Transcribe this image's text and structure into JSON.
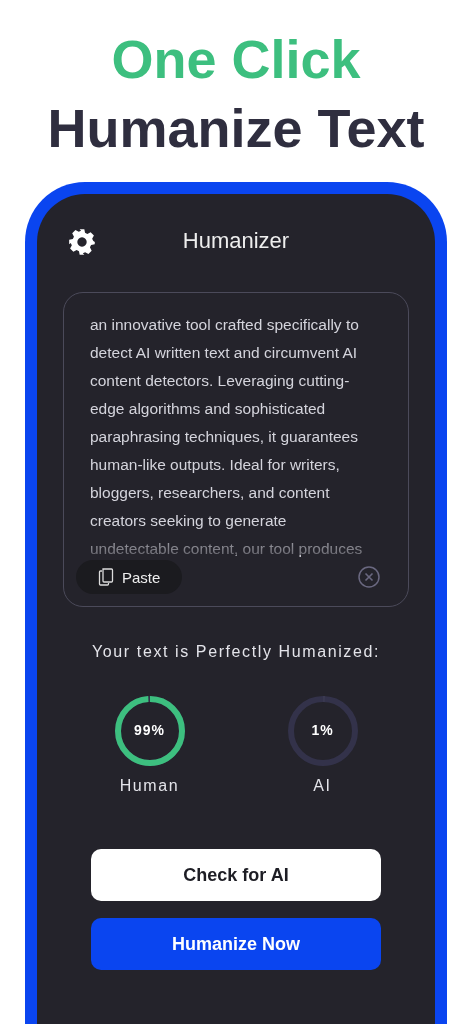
{
  "headline": {
    "accent": "One Click",
    "main": "Humanize Text"
  },
  "app": {
    "title": "Humanizer",
    "input": {
      "lines": [
        "an innovative tool crafted specifically to",
        "detect AI written text and circumvent AI",
        "content detectors. Leveraging cutting-",
        "edge algorithms and sophisticated",
        "paraphrasing techniques, it guarantees",
        "human-like outputs. Ideal for writers,",
        "bloggers, researchers, and content",
        "creators seeking to generate",
        "undetectable content, our tool produces"
      ],
      "paste_button": "Paste"
    },
    "result_caption": "Your text is Perfectly Humanized:",
    "scores": [
      {
        "value": "99%",
        "label": "Human",
        "level": 0.99,
        "color": "#3dbf7f"
      },
      {
        "value": "1%",
        "label": "AI",
        "level": 0.01,
        "color": "#3a3950"
      }
    ],
    "buttons": [
      {
        "label": "Check for AI",
        "kind": "secondary"
      },
      {
        "label": "Humanize Now",
        "kind": "primary"
      }
    ]
  }
}
